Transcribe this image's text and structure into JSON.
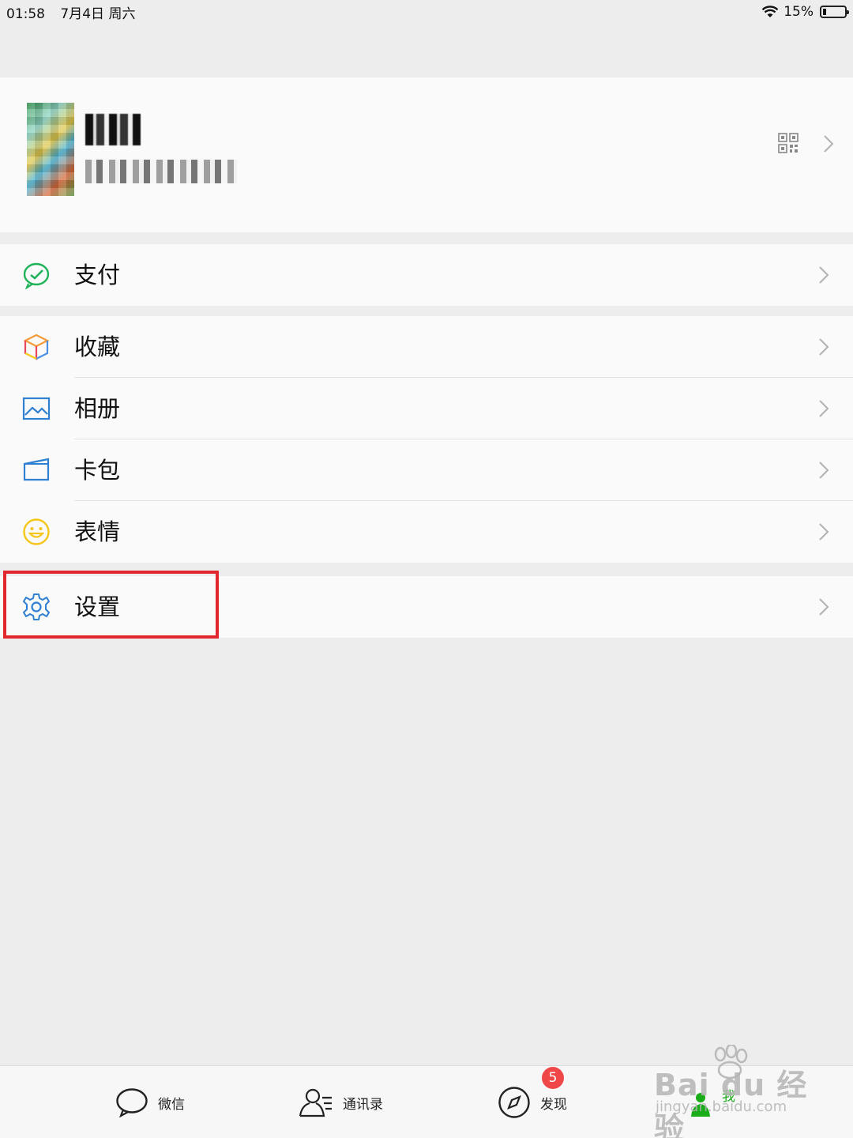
{
  "status_bar": {
    "time": "01:58",
    "date": "7月4日 周六",
    "battery": "15%"
  },
  "menu": {
    "pay": "支付",
    "favorites": "收藏",
    "album": "相册",
    "cards": "卡包",
    "stickers": "表情",
    "settings": "设置"
  },
  "tabbar": {
    "chats": "微信",
    "contacts": "通讯录",
    "discover": "发现",
    "discover_badge": "5",
    "me": "我"
  },
  "watermark": {
    "brand": "Bai du 经验",
    "url": "jingyan.baidu.com"
  },
  "colors": {
    "accent": "#1aad19",
    "highlight_box": "#e0282e",
    "badge": "#f04848"
  }
}
